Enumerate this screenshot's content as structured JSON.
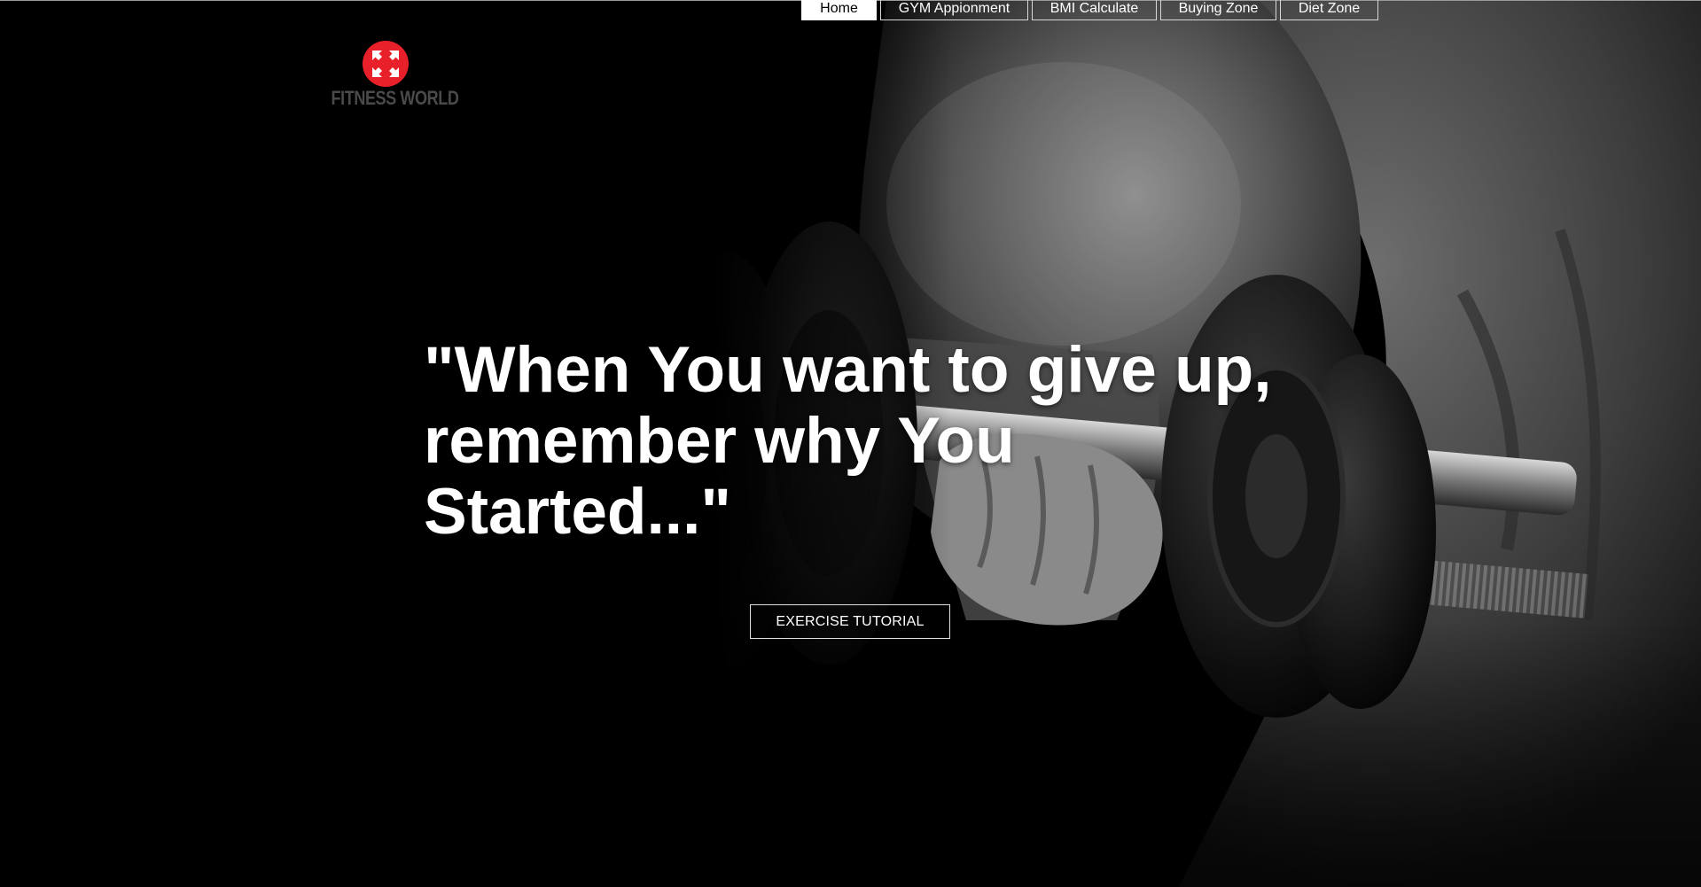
{
  "nav": {
    "items": [
      {
        "label": "Home",
        "active": true
      },
      {
        "label": "GYM Appionment",
        "active": false
      },
      {
        "label": "BMI Calculate",
        "active": false
      },
      {
        "label": "Buying Zone",
        "active": false
      },
      {
        "label": "Diet Zone",
        "active": false
      }
    ]
  },
  "logo": {
    "text": "FITNESS WORLD",
    "icon": "arrows-expand-icon",
    "color": "#e8202a"
  },
  "hero": {
    "headline_line1": "\"When You want to give up,",
    "headline_line2": "remember why You",
    "headline_line3": "Started...\"",
    "cta_label": "EXERCISE TUTORIAL",
    "background": "dumbbell-arm-photo"
  },
  "colors": {
    "background": "#000000",
    "text": "#ffffff",
    "nav_active_bg": "#ffffff",
    "nav_active_text": "#000000",
    "accent": "#e8202a"
  }
}
